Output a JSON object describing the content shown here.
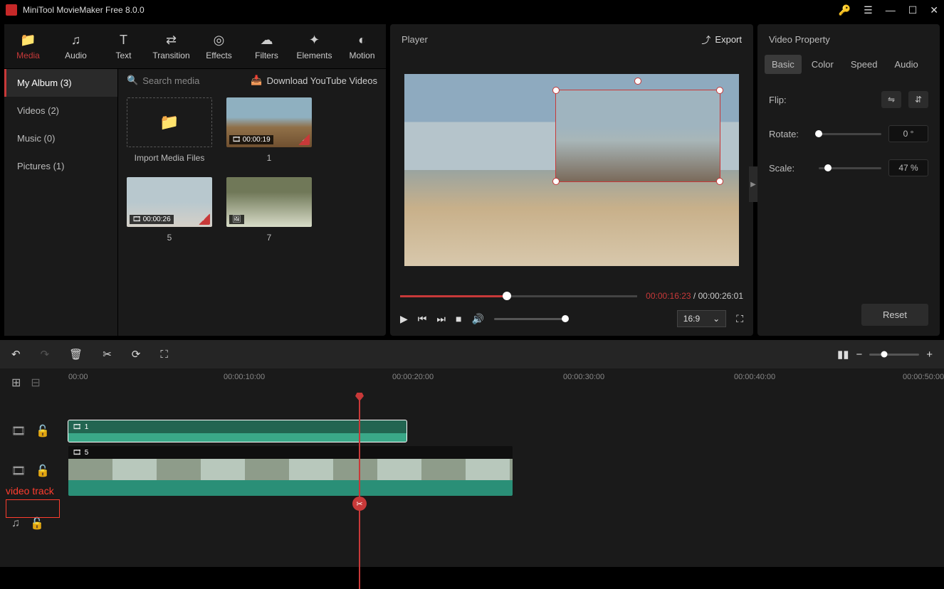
{
  "app": {
    "title": "MiniTool MovieMaker Free 8.0.0"
  },
  "toolbar": {
    "items": [
      {
        "label": "Media",
        "icon": "folder"
      },
      {
        "label": "Audio",
        "icon": "music"
      },
      {
        "label": "Text",
        "icon": "text"
      },
      {
        "label": "Transition",
        "icon": "transition"
      },
      {
        "label": "Effects",
        "icon": "effects"
      },
      {
        "label": "Filters",
        "icon": "filters"
      },
      {
        "label": "Elements",
        "icon": "sparkle"
      },
      {
        "label": "Motion",
        "icon": "motion"
      }
    ]
  },
  "album": {
    "items": [
      {
        "label": "My Album (3)"
      },
      {
        "label": "Videos (2)"
      },
      {
        "label": "Music (0)"
      },
      {
        "label": "Pictures (1)"
      }
    ]
  },
  "media": {
    "search_placeholder": "Search media",
    "download_label": "Download YouTube Videos",
    "import_label": "Import Media Files",
    "thumbs": [
      {
        "label": "1",
        "duration": "00:00:19",
        "type": "video",
        "checked": true
      },
      {
        "label": "5",
        "duration": "00:00:26",
        "type": "video",
        "checked": true
      },
      {
        "label": "7",
        "duration": "",
        "type": "image",
        "checked": false
      }
    ]
  },
  "player": {
    "title": "Player",
    "export": "Export",
    "current_time": "00:00:16:23",
    "total_time": "00:00:26:01",
    "progress_pct": 45,
    "aspect": "16:9"
  },
  "property": {
    "title": "Video Property",
    "tabs": [
      "Basic",
      "Color",
      "Speed",
      "Audio"
    ],
    "flip_label": "Flip:",
    "rotate_label": "Rotate:",
    "rotate_value": "0 °",
    "scale_label": "Scale:",
    "scale_value": "47 %",
    "reset": "Reset"
  },
  "timeline": {
    "ruler": [
      "00:00",
      "00:00:10:00",
      "00:00:20:00",
      "00:00:30:00",
      "00:00:40:00",
      "00:00:50:00"
    ],
    "clip1_label": "1",
    "clip2_label": "5",
    "annotation": "video track"
  }
}
